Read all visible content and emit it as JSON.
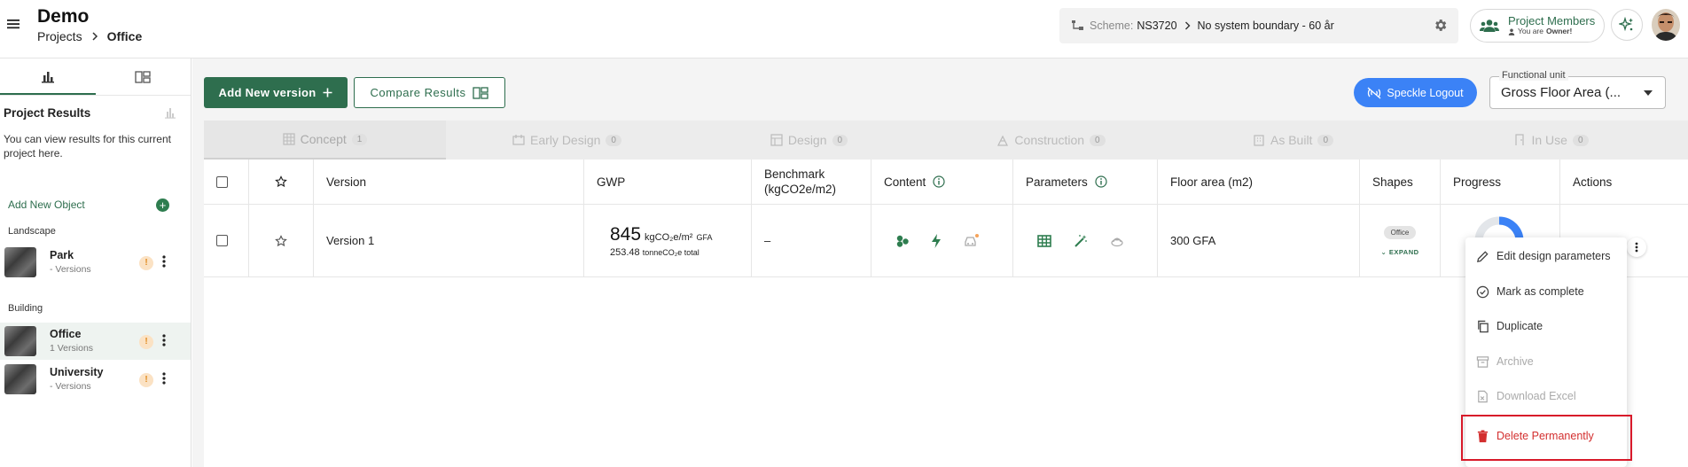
{
  "header": {
    "title": "Demo",
    "breadcrumb": [
      "Projects",
      "Office"
    ],
    "scheme_label": "Scheme:",
    "scheme_value": "NS3720",
    "scheme_boundary": "No system boundary - 60 år",
    "members_title": "Project Members",
    "members_sub_prefix": "You are",
    "members_role": "Owner!"
  },
  "sidebar": {
    "heading": "Project Results",
    "description": "You can view results for this current project here.",
    "add_object": "Add New Object",
    "groups": [
      {
        "label": "Landscape",
        "items": [
          {
            "name": "Park",
            "sub": "- Versions"
          }
        ]
      },
      {
        "label": "Building",
        "items": [
          {
            "name": "Office",
            "sub": "1 Versions",
            "active": true
          },
          {
            "name": "University",
            "sub": "- Versions"
          }
        ]
      }
    ]
  },
  "toolbar": {
    "add_version": "Add New version",
    "compare": "Compare Results",
    "speckle": "Speckle Logout",
    "functional_unit_label": "Functional unit",
    "functional_unit_value": "Gross Floor Area (..."
  },
  "phase_tabs": [
    {
      "label": "Concept",
      "count": "1",
      "active": true
    },
    {
      "label": "Early Design",
      "count": "0"
    },
    {
      "label": "Design",
      "count": "0"
    },
    {
      "label": "Construction",
      "count": "0"
    },
    {
      "label": "As Built",
      "count": "0"
    },
    {
      "label": "In Use",
      "count": "0"
    }
  ],
  "table": {
    "headers": {
      "version": "Version",
      "gwp": "GWP",
      "benchmark_1": "Benchmark",
      "benchmark_2": "(kgCO2e/m2)",
      "content": "Content",
      "parameters": "Parameters",
      "floor_area": "Floor area (m2)",
      "shapes": "Shapes",
      "progress": "Progress",
      "actions": "Actions"
    },
    "row": {
      "version": "Version 1",
      "gwp_value": "845",
      "gwp_unit": "kgCO₂e/m²",
      "gwp_unit_suffix": "GFA",
      "gwp_total": "253.48",
      "gwp_total_unit": "tonneCO₂e total",
      "benchmark": "–",
      "floor_area": "300 GFA",
      "shape": "Office",
      "expand": "EXPAND"
    }
  },
  "context_menu": [
    {
      "label": "Edit design parameters",
      "icon": "pencil-icon"
    },
    {
      "label": "Mark as complete",
      "icon": "check-circle-icon"
    },
    {
      "label": "Duplicate",
      "icon": "copy-icon"
    },
    {
      "label": "Archive",
      "icon": "archive-icon",
      "disabled": true
    },
    {
      "label": "Download Excel",
      "icon": "file-icon",
      "disabled": true
    },
    {
      "label": "Delete Permanently",
      "icon": "trash-icon",
      "danger": true
    }
  ],
  "colors": {
    "brand": "#2e6e4e",
    "speckle": "#3b82f6",
    "danger": "#d32f2f",
    "highlight": "#d8192a"
  }
}
